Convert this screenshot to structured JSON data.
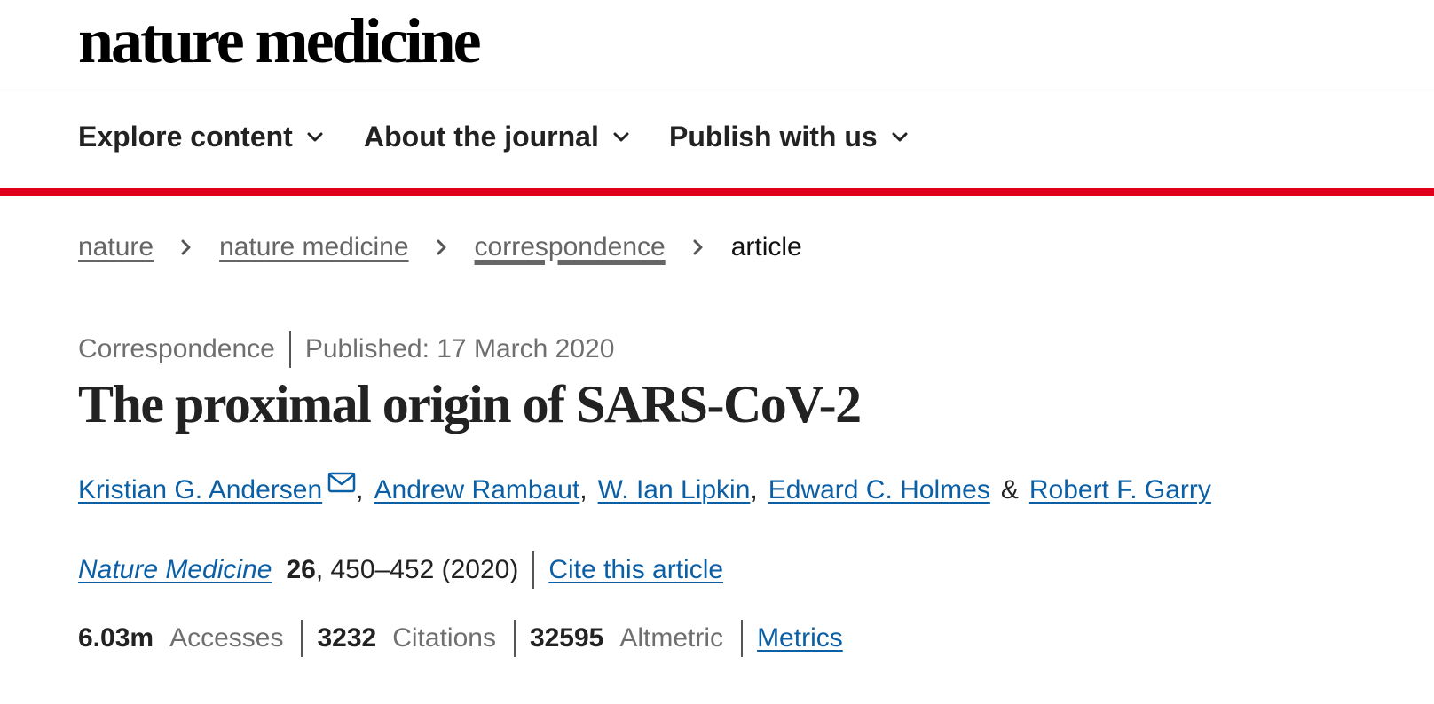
{
  "header": {
    "logo_text": "nature medicine"
  },
  "nav": {
    "items": [
      {
        "label": "Explore content"
      },
      {
        "label": "About the journal"
      },
      {
        "label": "Publish with us"
      }
    ]
  },
  "breadcrumb": {
    "items": [
      "nature",
      "nature medicine",
      "correspondence"
    ],
    "current": "article"
  },
  "article": {
    "type": "Correspondence",
    "published": "Published: 17 March 2020",
    "title": "The proximal origin of SARS-CoV-2",
    "authors": [
      "Kristian G. Andersen",
      "Andrew Rambaut",
      "W. Ian Lipkin",
      "Edward C. Holmes",
      "Robert F. Garry"
    ],
    "author_separators": [
      ",",
      ",",
      ",",
      "&"
    ],
    "journal": "Nature Medicine",
    "volume": "26",
    "pages_year": ", 450–452 (2020)",
    "cite_label": "Cite this article"
  },
  "metrics": {
    "accesses_value": "6.03m",
    "accesses_label": "Accesses",
    "citations_value": "3232",
    "citations_label": "Citations",
    "altmetric_value": "32595",
    "altmetric_label": "Altmetric",
    "link_label": "Metrics"
  },
  "colors": {
    "accent_red": "#e0001a",
    "link_blue": "#0b5fa5"
  }
}
